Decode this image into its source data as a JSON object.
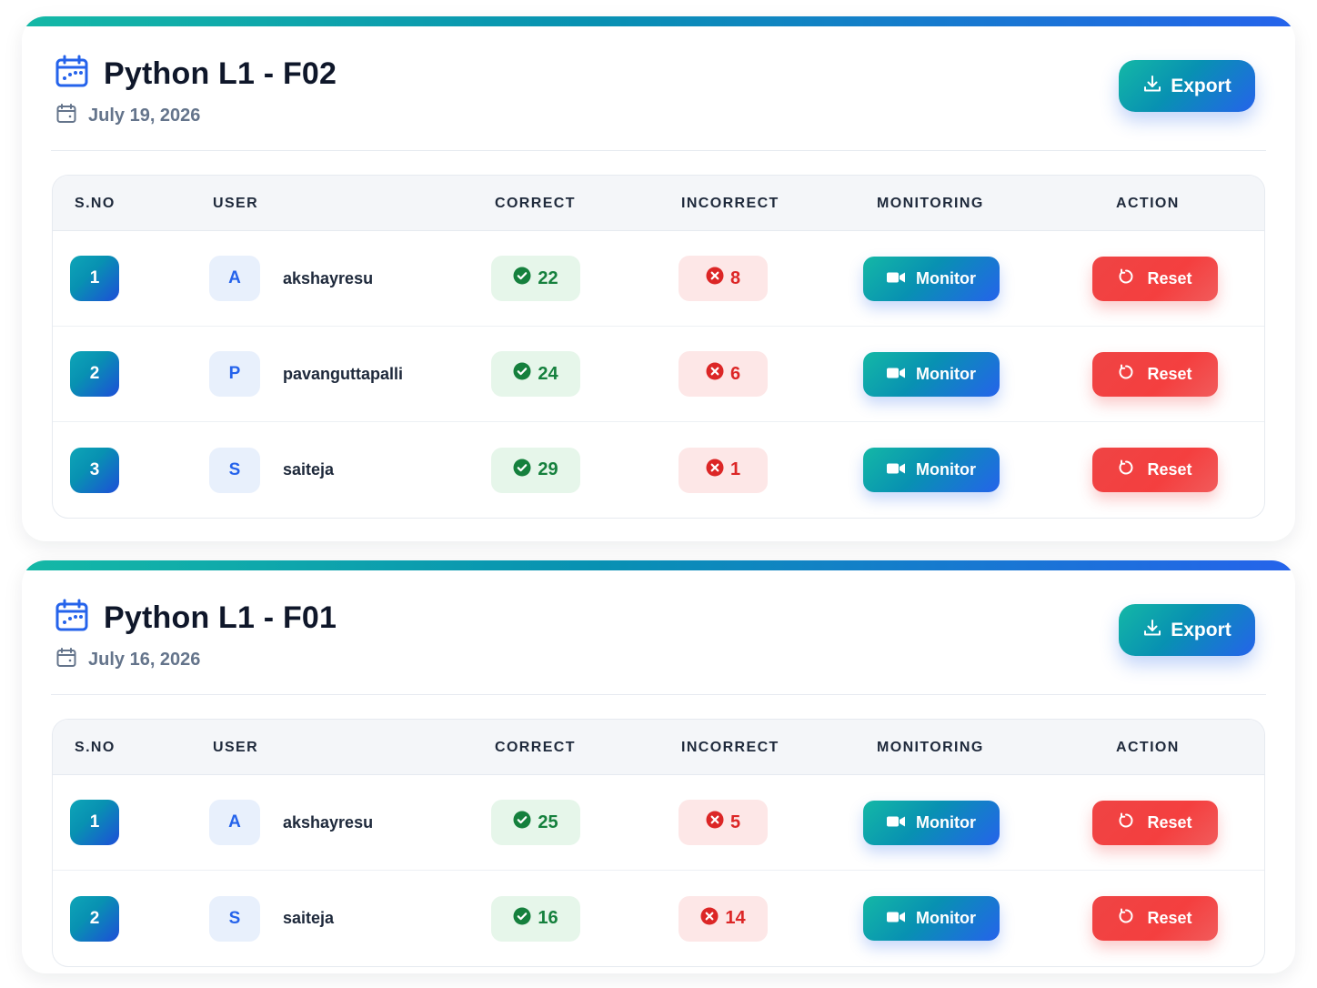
{
  "columns": {
    "sno": "S.NO",
    "user": "USER",
    "correct": "CORRECT",
    "incorrect": "INCORRECT",
    "monitoring": "MONITORING",
    "action": "ACTION"
  },
  "buttons": {
    "export": "Export",
    "monitor": "Monitor",
    "reset": "Reset"
  },
  "icons": {
    "title": "calendar-dots-icon",
    "date": "calendar-icon",
    "export": "download-icon",
    "correct": "check-circle-icon",
    "incorrect": "x-circle-icon",
    "monitor": "video-camera-icon",
    "reset": "rotate-icon"
  },
  "colors": {
    "accent_start": "#14b8a6",
    "accent_end": "#2563eb",
    "correct_bg": "#e6f6ea",
    "correct_text": "#15803d",
    "incorrect_bg": "#fde7e7",
    "incorrect_text": "#dc2626",
    "reset": "#ef4444"
  },
  "sessions": [
    {
      "title": "Python L1 - F02",
      "date": "July 19, 2026",
      "rows": [
        {
          "sno": "1",
          "initial": "A",
          "user": "akshayresu",
          "correct": "22",
          "incorrect": "8"
        },
        {
          "sno": "2",
          "initial": "P",
          "user": "pavanguttapalli",
          "correct": "24",
          "incorrect": "6"
        },
        {
          "sno": "3",
          "initial": "S",
          "user": "saiteja",
          "correct": "29",
          "incorrect": "1"
        }
      ]
    },
    {
      "title": "Python L1 - F01",
      "date": "July 16, 2026",
      "rows": [
        {
          "sno": "1",
          "initial": "A",
          "user": "akshayresu",
          "correct": "25",
          "incorrect": "5"
        },
        {
          "sno": "2",
          "initial": "S",
          "user": "saiteja",
          "correct": "16",
          "incorrect": "14"
        }
      ]
    }
  ]
}
